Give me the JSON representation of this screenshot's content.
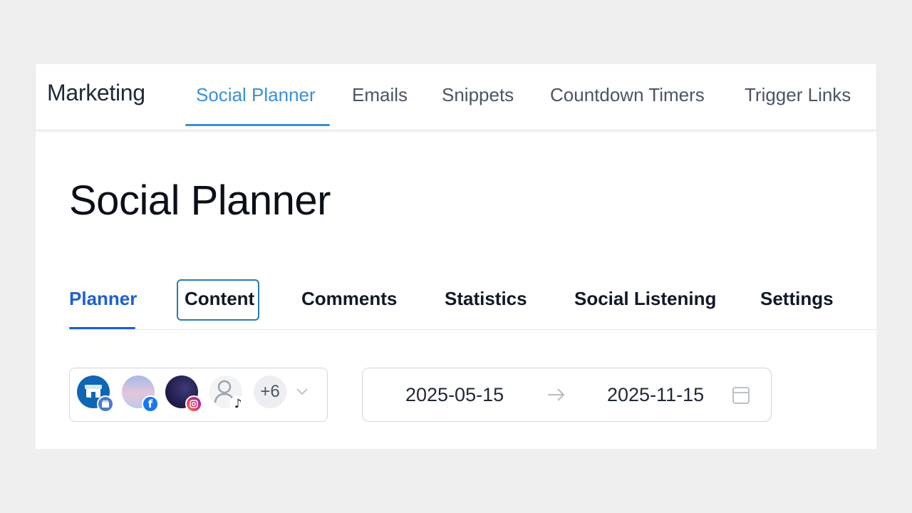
{
  "header": {
    "brand": "Marketing",
    "tabs": [
      {
        "label": "Social Planner",
        "active": true
      },
      {
        "label": "Emails"
      },
      {
        "label": "Snippets"
      },
      {
        "label": "Countdown Timers"
      },
      {
        "label": "Trigger Links"
      }
    ]
  },
  "page": {
    "title": "Social Planner",
    "tabs": [
      {
        "label": "Planner",
        "active": true
      },
      {
        "label": "Content"
      },
      {
        "label": "Comments"
      },
      {
        "label": "Statistics"
      },
      {
        "label": "Social Listening"
      },
      {
        "label": "Settings"
      }
    ]
  },
  "accounts": {
    "items": [
      {
        "avatar": "store-icon",
        "network": "google-business-icon"
      },
      {
        "avatar": "sky-photo",
        "network": "facebook-icon"
      },
      {
        "avatar": "night-photo",
        "network": "instagram-icon"
      },
      {
        "avatar": "user-placeholder-icon",
        "network": "tiktok-icon"
      }
    ],
    "more_label": "+6"
  },
  "date_range": {
    "start": "2025-05-15",
    "end": "2025-11-15"
  },
  "colors": {
    "accent": "#3b8fd6",
    "active_subtab": "#1d5fd1",
    "focus_ring": "#2c7ab3",
    "facebook": "#1877f2"
  }
}
